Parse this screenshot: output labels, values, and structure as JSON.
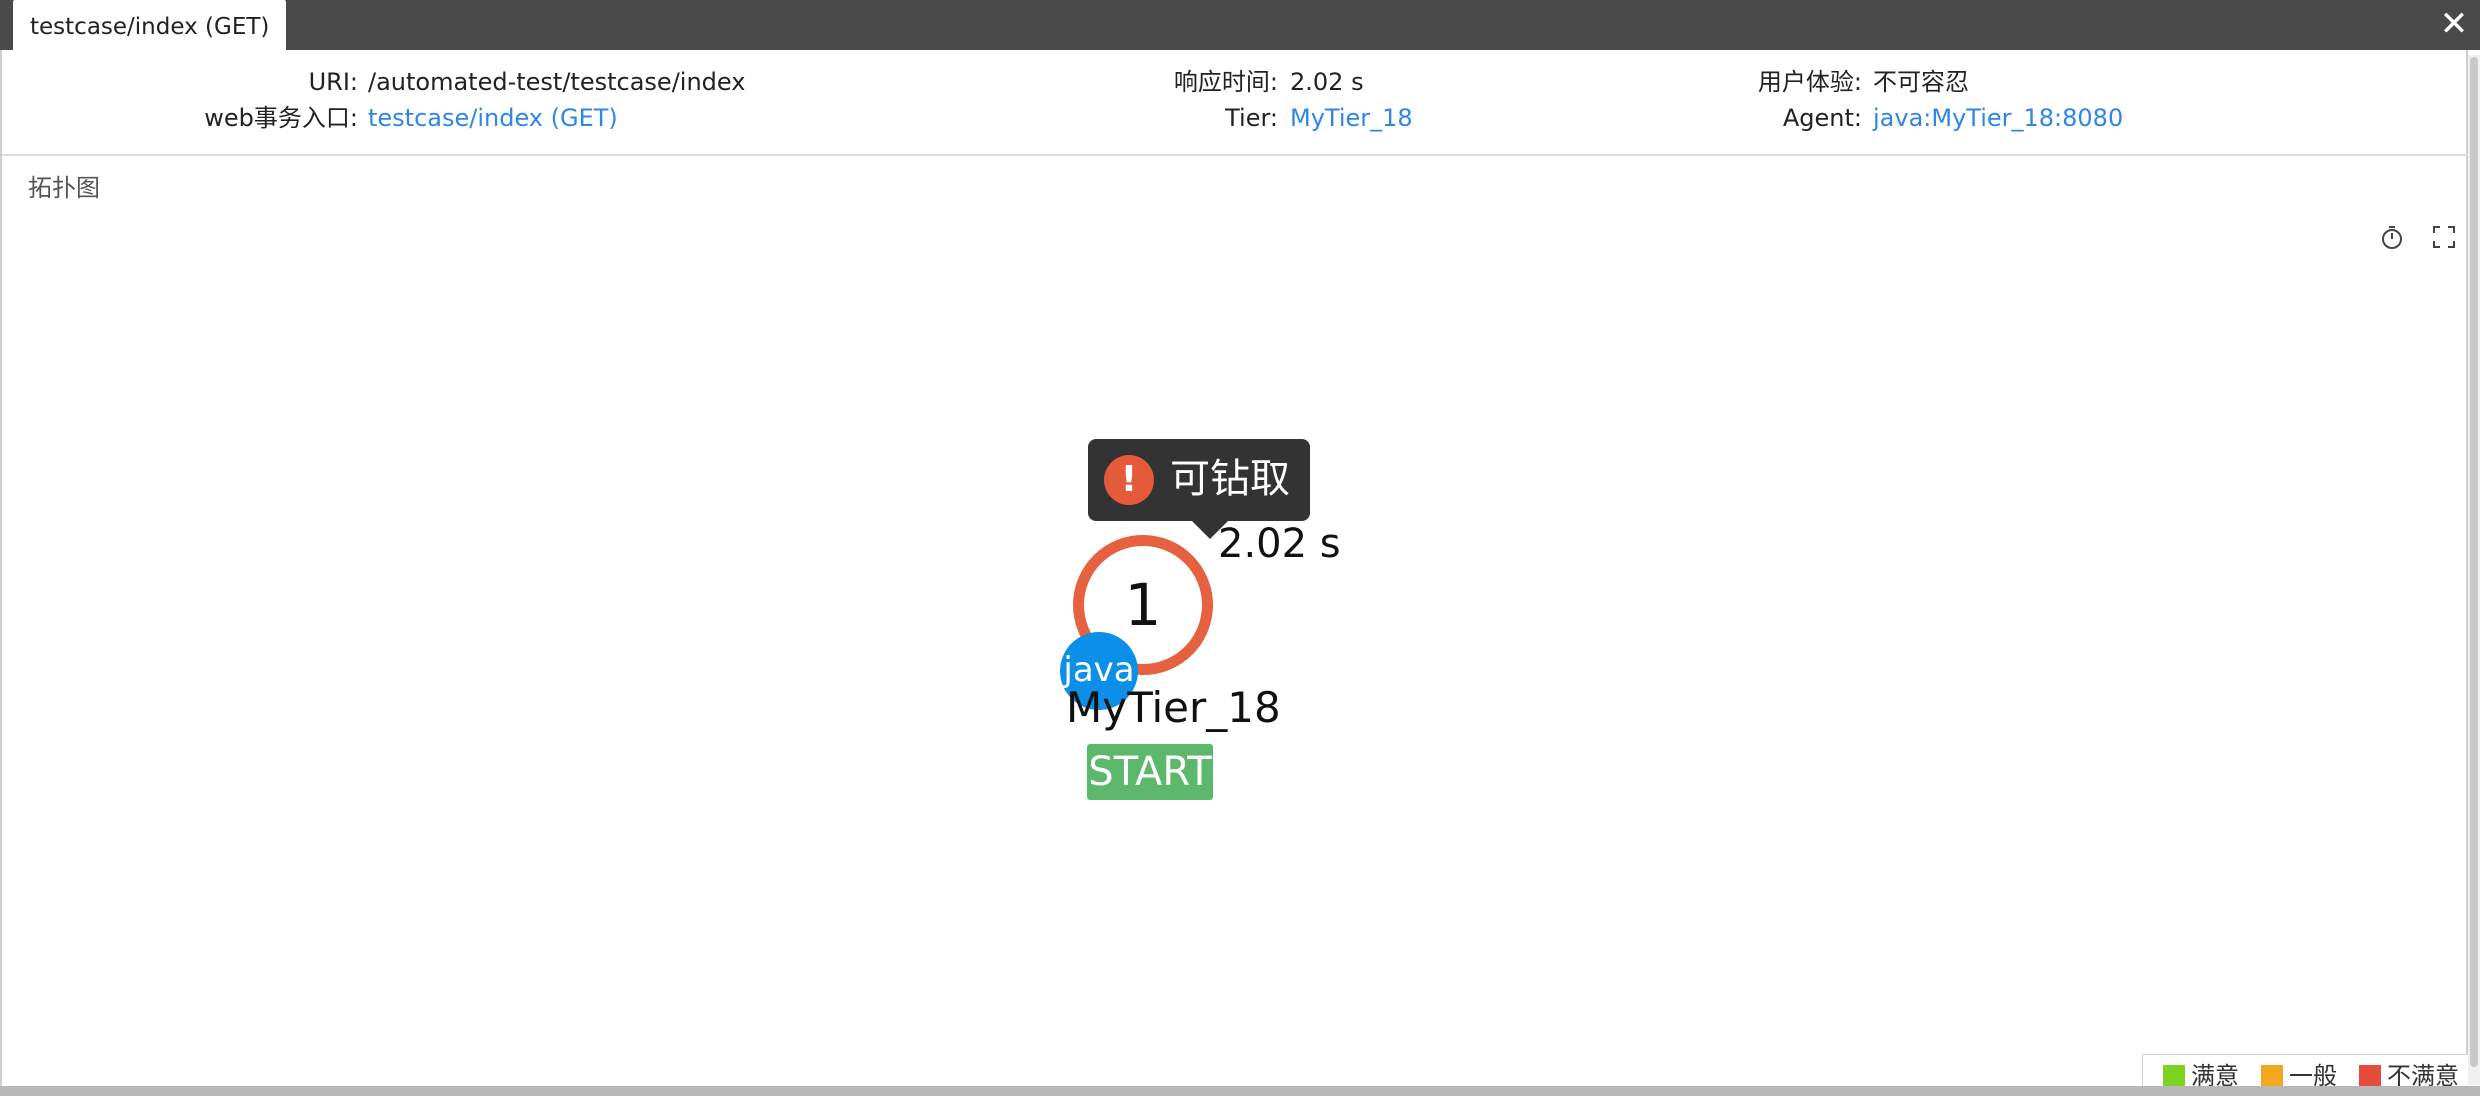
{
  "window": {
    "tab_title": "testcase/index (GET)"
  },
  "info": {
    "uri_label": "URI:",
    "uri_value": "/automated-test/testcase/index",
    "entry_label": "web事务入口:",
    "entry_value": "testcase/index (GET)",
    "response_label": "响应时间:",
    "response_value": "2.02 s",
    "tier_label": "Tier:",
    "tier_value": "MyTier_18",
    "experience_label": "用户体验:",
    "experience_value": "不可容忍",
    "agent_label": "Agent:",
    "agent_value": "java:MyTier_18:8080"
  },
  "topology": {
    "section_title": "拓扑图",
    "tooltip_text": "可钻取",
    "warning_glyph": "!",
    "latency": "2.02 s",
    "node_count": "1",
    "node_type": "java",
    "tier_name": "MyTier_18",
    "start_label": "START",
    "icons": [
      "timer-icon",
      "fullscreen-icon"
    ]
  },
  "legend": [
    {
      "label": "满意",
      "color": "#7ed321"
    },
    {
      "label": "一般",
      "color": "#f5a623"
    },
    {
      "label": "不满意",
      "color": "#e54c3c"
    }
  ],
  "colors": {
    "link": "#2f86e6",
    "alert_ring": "#e5613f",
    "java_badge": "#0b8fe8",
    "start_tag": "#5cb96b",
    "tooltip_bg": "#333333"
  }
}
